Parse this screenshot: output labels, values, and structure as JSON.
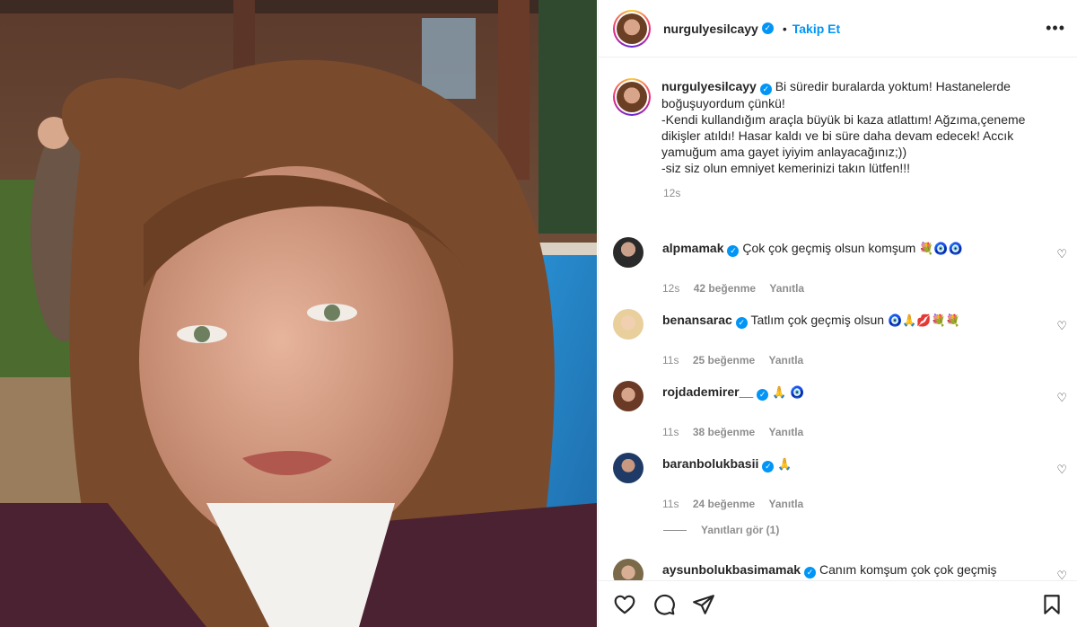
{
  "post": {
    "username": "nurgulyesilcayy",
    "follow_label": "Takip Et",
    "separator": "•",
    "more_label": "•••",
    "caption_user": "nurgulyesilcayy",
    "caption_text": "Bi süredir buralarda yoktum! Hastanelerde boğuşuyordum çünkü!\n-Kendi kullandığım araçla büyük bi kaza atlattım! Ağzıma,çeneme dikişler atıldı! Hasar kaldı ve bi süre daha devam edecek! Accık yamuğum ama gayet iyiyim anlayacağınız;))\n-siz siz olun emniyet kemerinizi takın lütfen!!!",
    "caption_time": "12s"
  },
  "comments": [
    {
      "user": "alpmamak",
      "text": "Çok çok geçmiş olsun komşum",
      "emoji": "💐🧿🧿",
      "time": "12s",
      "likes": "42 beğenme",
      "reply": "Yanıtla"
    },
    {
      "user": "benansarac",
      "text": "Tatlım çok geçmiş olsun",
      "emoji": "🧿🙏💋💐💐",
      "time": "11s",
      "likes": "25 beğenme",
      "reply": "Yanıtla"
    },
    {
      "user": "rojdademirer__",
      "text": "",
      "emoji": "🙏 🧿",
      "time": "11s",
      "likes": "38 beğenme",
      "reply": "Yanıtla"
    },
    {
      "user": "baranbolukbasii",
      "text": "",
      "emoji": "🙏",
      "time": "11s",
      "likes": "24 beğenme",
      "reply": "Yanıtla"
    },
    {
      "user": "aysunbolukbasimamak",
      "text": "Canım komşum çok çok geçmiş",
      "emoji": "",
      "time": "",
      "likes": "",
      "reply": ""
    }
  ],
  "view_replies": "Yanıtları gör (1)",
  "icons": {
    "like": "heart-icon",
    "comment": "comment-icon",
    "share": "share-icon",
    "save": "bookmark-icon",
    "verified": "verified-badge-icon",
    "more": "more-options-icon"
  },
  "colors": {
    "accent": "#0095f6",
    "text": "#262626",
    "muted": "#8e8e8e"
  }
}
